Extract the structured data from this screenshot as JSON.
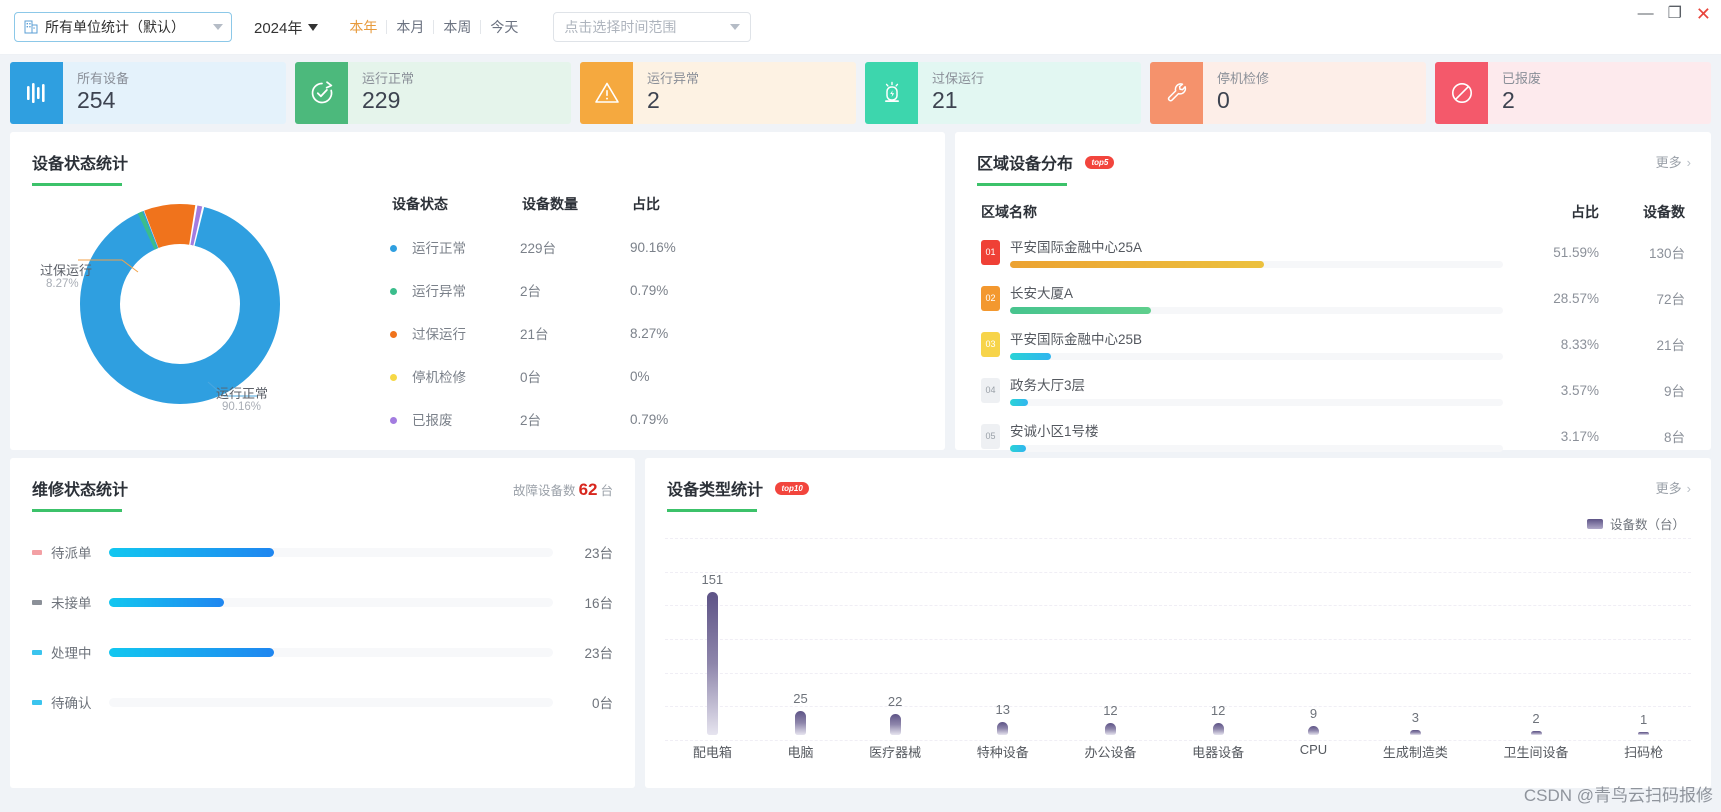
{
  "topbar": {
    "unit_select": {
      "label": "所有单位统计（默认）",
      "icon": "building-icon",
      "caret": "chevron-down-icon"
    },
    "year": "2024年",
    "range_tabs": [
      {
        "label": "本年",
        "active": true
      },
      {
        "label": "本月",
        "active": false
      },
      {
        "label": "本周",
        "active": false
      },
      {
        "label": "今天",
        "active": false
      }
    ],
    "date_placeholder": "点击选择时间范围",
    "window": {
      "minimize": "—",
      "maximize": "❐",
      "close": "✕"
    }
  },
  "cards": [
    {
      "title": "所有设备",
      "value": "254",
      "icon": "bars-icon",
      "icon_bg": "#2f9fe0",
      "bg": "#e4f2fb"
    },
    {
      "title": "运行正常",
      "value": "229",
      "icon": "check-refresh-icon",
      "icon_bg": "#4cb97c",
      "bg": "#e5f4eb"
    },
    {
      "title": "运行异常",
      "value": "2",
      "icon": "warning-icon",
      "icon_bg": "#f5a93f",
      "bg": "#fdf2e3"
    },
    {
      "title": "过保运行",
      "value": "21",
      "icon": "alarm-icon",
      "icon_bg": "#3dd6ad",
      "bg": "#e2f7f2"
    },
    {
      "title": "停机检修",
      "value": "0",
      "icon": "wrench-icon",
      "icon_bg": "#f5926c",
      "bg": "#fdeee8"
    },
    {
      "title": "已报废",
      "value": "2",
      "icon": "ban-icon",
      "icon_bg": "#f4596b",
      "bg": "#fdeaed"
    }
  ],
  "device_status": {
    "title": "设备状态统计",
    "columns": [
      "设备状态",
      "设备数量",
      "占比"
    ],
    "rows": [
      {
        "label": "运行正常",
        "count": "229台",
        "pct": "90.16%",
        "color": "#2f9fe0"
      },
      {
        "label": "运行异常",
        "count": "2台",
        "pct": "0.79%",
        "color": "#3bbd8c"
      },
      {
        "label": "过保运行",
        "count": "21台",
        "pct": "8.27%",
        "color": "#f0731c"
      },
      {
        "label": "停机检修",
        "count": "0台",
        "pct": "0%",
        "color": "#f6d846"
      },
      {
        "label": "已报废",
        "count": "2台",
        "pct": "0.79%",
        "color": "#a37ce0"
      }
    ],
    "chart_data": {
      "type": "pie",
      "title": "设备状态统计",
      "labels": [
        "运行正常",
        "运行异常",
        "过保运行",
        "停机检修",
        "已报废"
      ],
      "values": [
        229,
        2,
        21,
        0,
        2
      ],
      "percents": [
        90.16,
        0.79,
        8.27,
        0,
        0.79
      ],
      "colors": [
        "#2f9fe0",
        "#3bbd8c",
        "#f0731c",
        "#f6d846",
        "#a37ce0"
      ],
      "annotations": [
        {
          "text": "过保运行",
          "sub": "8.27%"
        },
        {
          "text": "运行正常",
          "sub": "90.16%"
        }
      ],
      "legend": "right-table",
      "donut": true
    },
    "callout_top": {
      "name": "过保运行",
      "pct": "8.27%"
    },
    "callout_bottom": {
      "name": "运行正常",
      "pct": "90.16%"
    }
  },
  "region": {
    "title": "区域设备分布",
    "badge": "top5",
    "more": "更多",
    "columns": {
      "name": "区域名称",
      "pct": "占比",
      "count": "设备数"
    },
    "rows": [
      {
        "rank": "01",
        "rank_bg": "#ef4036",
        "name": "平安国际金融中心25A",
        "pct": "51.59%",
        "count": "130台",
        "bar_pct": 51.59,
        "bar_from": "#eca231",
        "bar_to": "#ecc13e"
      },
      {
        "rank": "02",
        "rank_bg": "#f3982f",
        "name": "长安大厦A",
        "pct": "28.57%",
        "count": "72台",
        "bar_pct": 28.57,
        "bar_from": "#47c48e",
        "bar_to": "#5fcf8d"
      },
      {
        "rank": "03",
        "rank_bg": "#f7d44a",
        "name": "平安国际金融中心25B",
        "pct": "8.33%",
        "count": "21台",
        "bar_pct": 8.33,
        "bar_from": "#2ad3d6",
        "bar_to": "#31b5ef"
      },
      {
        "rank": "04",
        "rank_bg": "#eef0f3",
        "name": "政务大厅3层",
        "pct": "3.57%",
        "count": "9台",
        "bar_pct": 3.57,
        "bar_from": "#2ad3d6",
        "bar_to": "#31b5ef"
      },
      {
        "rank": "05",
        "rank_bg": "#eef0f3",
        "name": "安诚小区1号楼",
        "pct": "3.17%",
        "count": "8台",
        "bar_pct": 3.17,
        "bar_from": "#2ad3d6",
        "bar_to": "#31b5ef"
      }
    ]
  },
  "maintenance": {
    "title": "维修状态统计",
    "fault_label": "故障设备数",
    "fault_value": "62",
    "fault_unit": "台",
    "chart_data": {
      "type": "bar",
      "orientation": "horizontal",
      "title": "维修状态统计",
      "categories": [
        "待派单",
        "未接单",
        "处理中",
        "待确认"
      ],
      "values": [
        23,
        16,
        23,
        0
      ],
      "value_labels": [
        "23台",
        "16台",
        "23台",
        "0台"
      ],
      "max": 62
    },
    "rows": [
      {
        "label": "待派单",
        "value": "23台",
        "pct": 37.1,
        "sq": "#f3a0a4"
      },
      {
        "label": "未接单",
        "value": "16台",
        "pct": 25.8,
        "sq": "#8b9098"
      },
      {
        "label": "处理中",
        "value": "23台",
        "pct": 37.1,
        "sq": "#3bc4ee"
      },
      {
        "label": "待确认",
        "value": "0台",
        "pct": 0,
        "sq": "#3bc4ee"
      }
    ]
  },
  "device_type": {
    "title": "设备类型统计",
    "badge": "top10",
    "more": "更多",
    "legend": "设备数（台）",
    "chart_data": {
      "type": "bar",
      "title": "设备类型统计",
      "categories": [
        "配电箱",
        "电脑",
        "医疗器械",
        "特种设备",
        "办公设备",
        "电器设备",
        "CPU",
        "生成制造类",
        "卫生间设备",
        "扫码枪"
      ],
      "values": [
        151,
        25,
        22,
        13,
        12,
        12,
        9,
        3,
        2,
        1
      ],
      "ylabel": "设备数（台）",
      "xlabel": "",
      "ylim": [
        0,
        160
      ],
      "legend_position": "top-right",
      "grid": true
    }
  },
  "watermark": "CSDN @青鸟云扫码报修"
}
